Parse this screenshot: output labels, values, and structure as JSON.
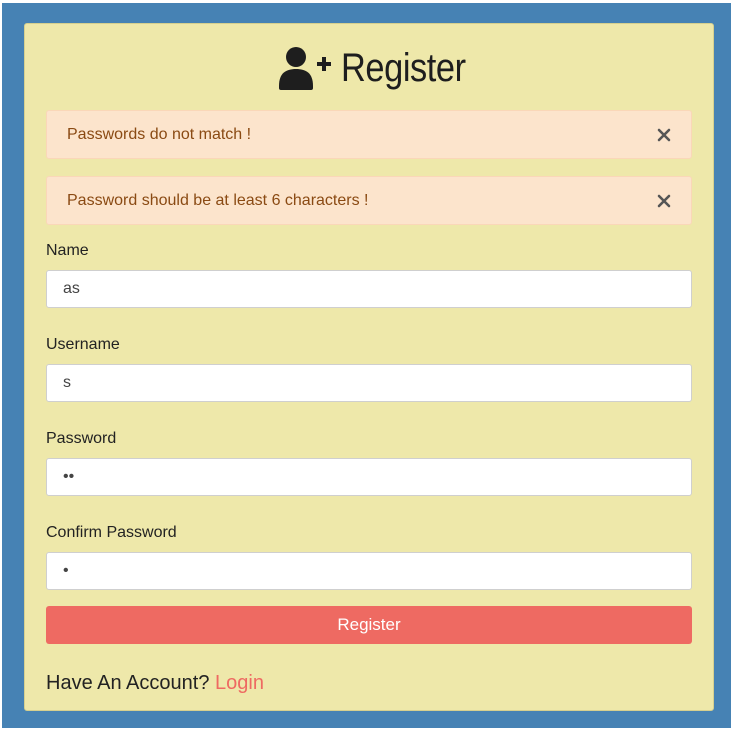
{
  "page": {
    "title": "Register",
    "title_icon": "user-plus-icon",
    "colors": {
      "background": "#4682b4",
      "card": "#eee8aa",
      "alert_background": "#fce4cc",
      "alert_text": "#8a4a13",
      "accent": "#ee6a62"
    }
  },
  "alerts": [
    {
      "message": "Passwords do not match !",
      "close_icon": "close-icon"
    },
    {
      "message": "Password should be at least 6 characters !",
      "close_icon": "close-icon"
    }
  ],
  "form": {
    "name": {
      "label": "Name",
      "value": "as"
    },
    "username": {
      "label": "Username",
      "value": "s"
    },
    "password": {
      "label": "Password",
      "value": "ab"
    },
    "confirm_password": {
      "label": "Confirm Password",
      "value": "a"
    },
    "submit_label": "Register"
  },
  "footer": {
    "prompt": "Have An Account?",
    "link_label": "Login"
  }
}
